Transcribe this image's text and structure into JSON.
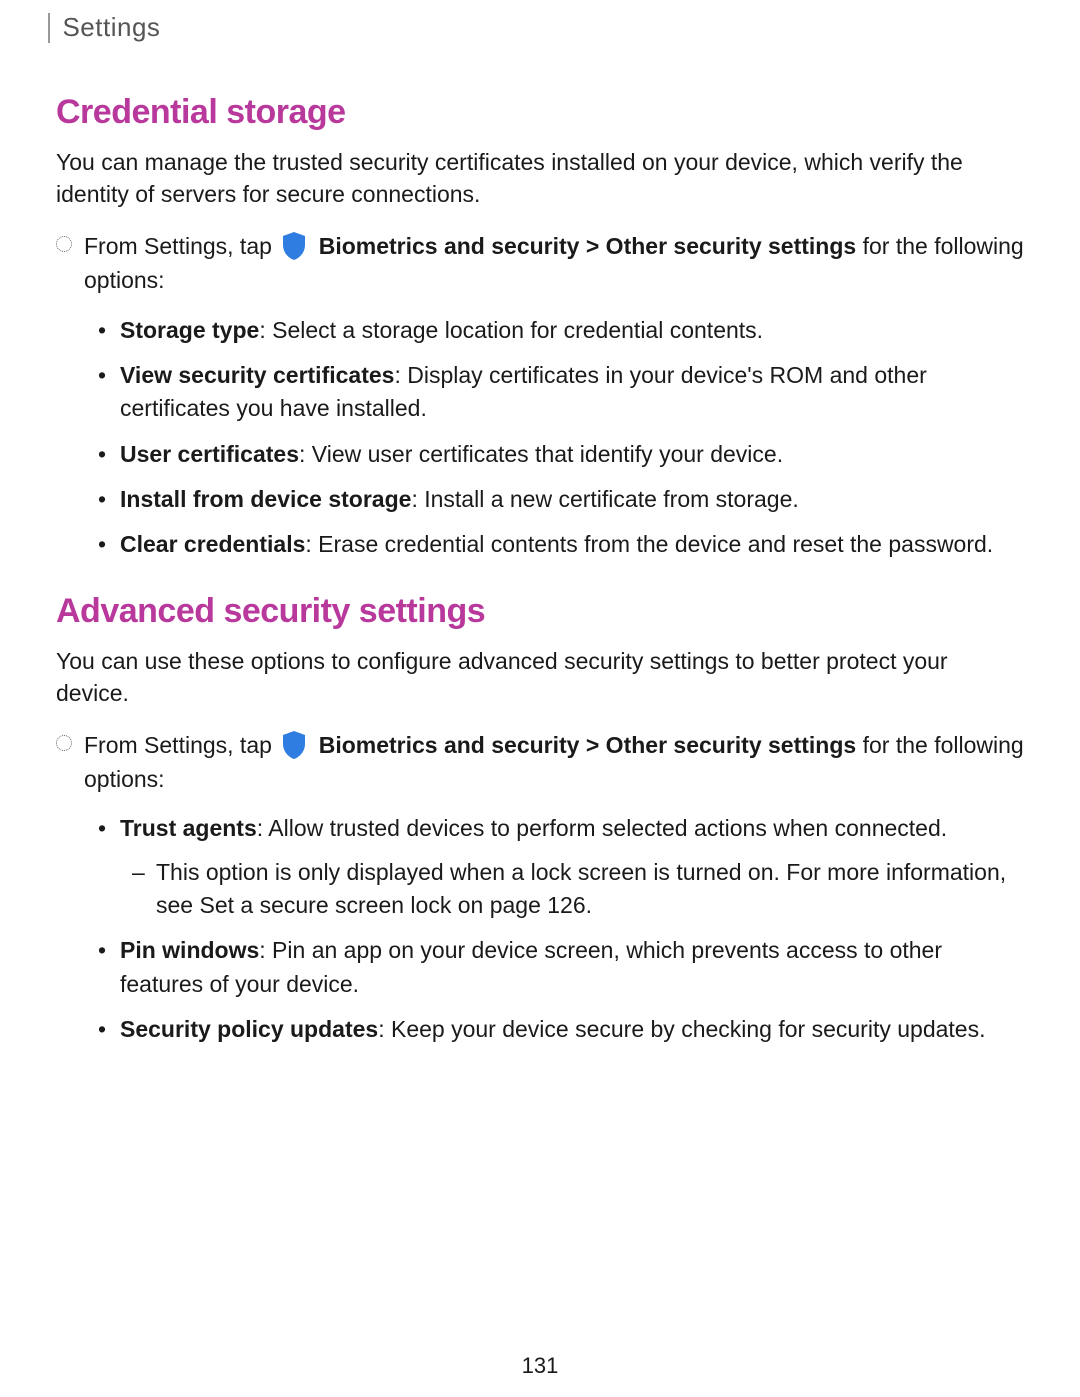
{
  "header": {
    "title": "Settings"
  },
  "section1": {
    "heading": "Credential storage",
    "intro": "You can manage the trusted security certificates installed on your device, which verify the identity of servers for secure connections.",
    "instruction_prefix": "From Settings, tap ",
    "instruction_path": "Biometrics and security > Other security settings",
    "instruction_suffix": " for the following options:",
    "options": [
      {
        "title": "Storage type",
        "desc": ": Select a storage location for credential contents."
      },
      {
        "title": "View security certificates",
        "desc": ": Display certificates in your device's ROM and other certificates you have installed."
      },
      {
        "title": "User certificates",
        "desc": ": View user certificates that identify your device."
      },
      {
        "title": "Install from device storage",
        "desc": ": Install a new certificate from storage."
      },
      {
        "title": "Clear credentials",
        "desc": ": Erase credential contents from the device and reset the password."
      }
    ]
  },
  "section2": {
    "heading": "Advanced security settings",
    "intro": "You can use these options to configure advanced security settings to better protect your device.",
    "instruction_prefix": "From Settings, tap ",
    "instruction_path": "Biometrics and security > Other security settings",
    "instruction_suffix": " for the following options:",
    "options": [
      {
        "title": "Trust agents",
        "desc": ": Allow trusted devices to perform selected actions when connected.",
        "sub": {
          "text_before": "This option is only displayed when a lock screen is turned on. For more information, see ",
          "link_text": "Set a secure screen lock",
          "text_after": " on page 126."
        }
      },
      {
        "title": "Pin windows",
        "desc": ": Pin an app on your device screen, which prevents access to other features of your device."
      },
      {
        "title": "Security policy updates",
        "desc": ": Keep your device secure by checking for security updates."
      }
    ]
  },
  "page_number": "131"
}
